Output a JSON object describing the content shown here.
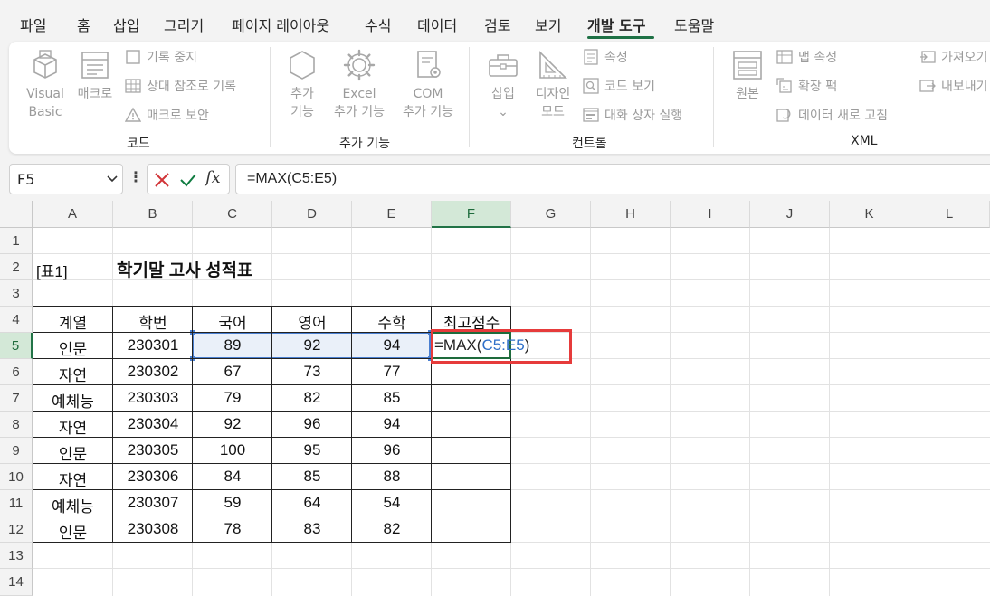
{
  "menu": {
    "items": [
      "파일",
      "홈",
      "삽입",
      "그리기",
      "페이지 레이아웃",
      "수식",
      "데이터",
      "검토",
      "보기",
      "개발 도구",
      "도움말"
    ],
    "active": "개발 도구"
  },
  "ribbon": {
    "code": {
      "group_label": "코드",
      "visual_basic": "Visual\nBasic",
      "macro": "매크로",
      "record_stop": "기록 중지",
      "relative_ref": "상대 참조로 기록",
      "macro_security": "매크로 보안"
    },
    "addins": {
      "group_label": "추가 기능",
      "addins": "추가\n기능",
      "excel_addins": "Excel\n추가 기능",
      "com_addins": "COM\n추가 기능"
    },
    "controls": {
      "group_label": "컨트롤",
      "insert": "삽입",
      "insert_arrow": "⌄",
      "design_mode": "디자인\n모드",
      "properties": "속성",
      "view_code": "코드 보기",
      "run_dialog": "대화 상자 실행"
    },
    "xml": {
      "group_label": "XML",
      "source": "원본",
      "map_properties": "맵 속성",
      "expansion_packs": "확장 팩",
      "refresh_data": "데이터 새로 고침",
      "import": "가져오기",
      "export": "내보내기"
    }
  },
  "formula_bar": {
    "name_box": "F5",
    "formula": "=MAX(C5:E5)"
  },
  "sheet": {
    "columns": [
      "A",
      "B",
      "C",
      "D",
      "E",
      "F",
      "G",
      "H",
      "I",
      "J",
      "K",
      "L"
    ],
    "rows": [
      "1",
      "2",
      "3",
      "4",
      "5",
      "6",
      "7",
      "8",
      "9",
      "10",
      "11",
      "12",
      "13",
      "14"
    ],
    "label": "[표1]",
    "title": "학기말 고사 성적표",
    "headers": [
      "계열",
      "학번",
      "국어",
      "영어",
      "수학",
      "최고점수"
    ],
    "data": [
      [
        "인문",
        "230301",
        "89",
        "92",
        "94"
      ],
      [
        "자연",
        "230302",
        "67",
        "73",
        "77"
      ],
      [
        "예체능",
        "230303",
        "79",
        "82",
        "85"
      ],
      [
        "자연",
        "230304",
        "92",
        "96",
        "94"
      ],
      [
        "인문",
        "230305",
        "100",
        "95",
        "96"
      ],
      [
        "자연",
        "230306",
        "84",
        "85",
        "88"
      ],
      [
        "예체능",
        "230307",
        "59",
        "64",
        "54"
      ],
      [
        "인문",
        "230308",
        "78",
        "83",
        "82"
      ]
    ],
    "edit_prefix": "=MAX(",
    "edit_ref": "C5:E5",
    "edit_suffix": ")"
  }
}
